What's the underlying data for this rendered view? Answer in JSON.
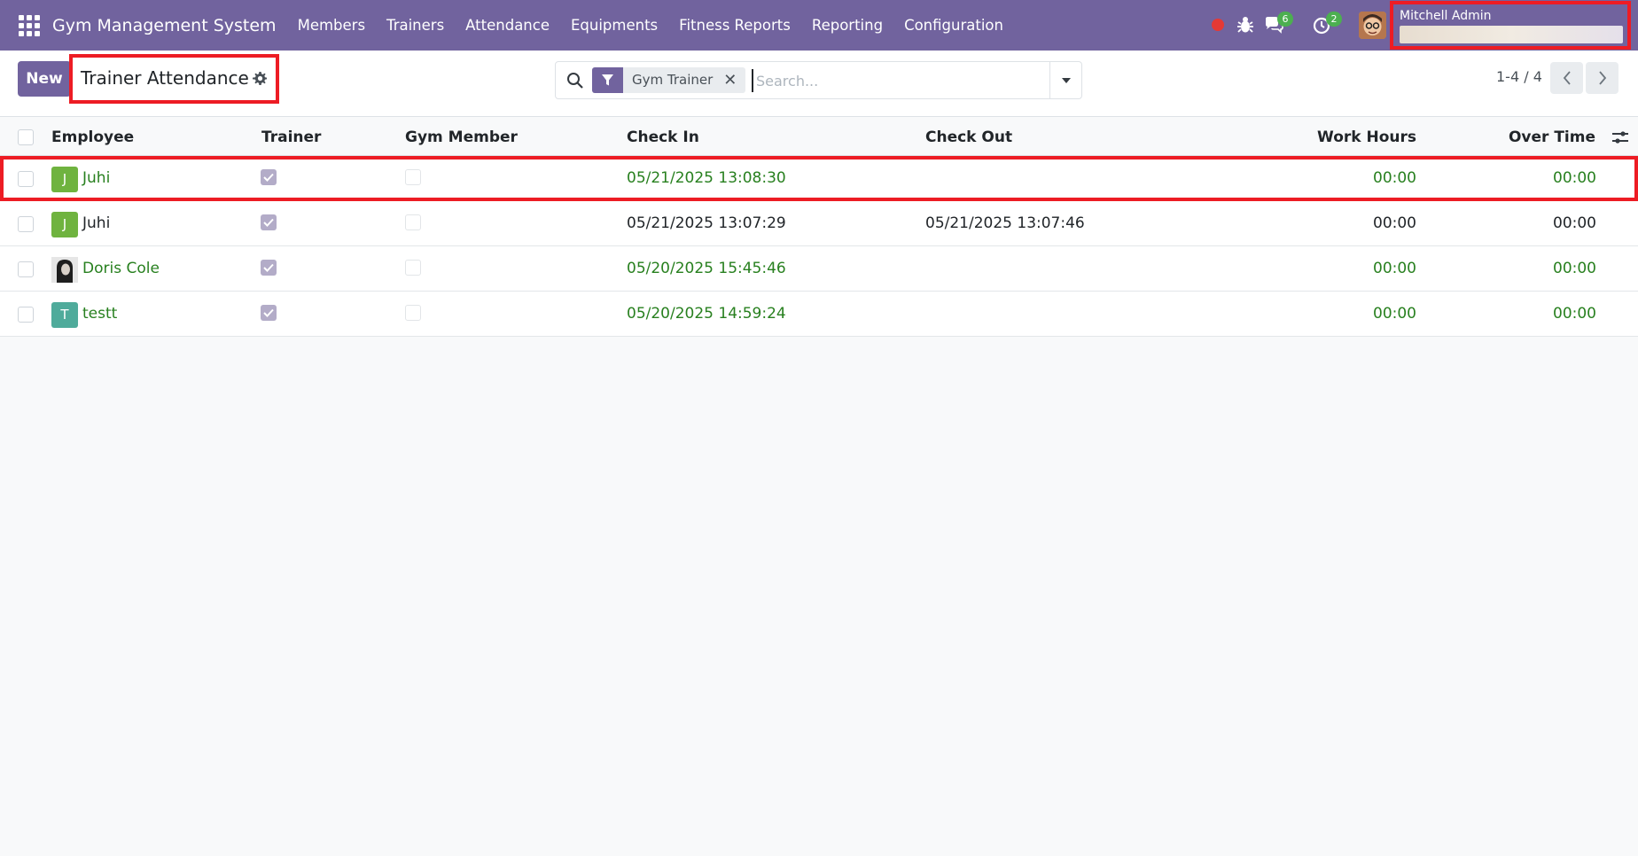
{
  "navbar": {
    "brand": "Gym Management System",
    "menu": [
      "Members",
      "Trainers",
      "Attendance",
      "Equipments",
      "Fitness Reports",
      "Reporting",
      "Configuration"
    ],
    "messages_badge": "6",
    "activities_badge": "2",
    "user_name": "Mitchell Admin",
    "colors": {
      "navbar": "#71639e",
      "badge": "#4caf50",
      "record_dot": "#e53935"
    }
  },
  "control_panel": {
    "new_label": "New",
    "title": "Trainer Attendance",
    "search": {
      "facet_label": "Gym Trainer",
      "placeholder": "Search..."
    },
    "pager": "1-4 / 4"
  },
  "table": {
    "columns": [
      "Employee",
      "Trainer",
      "Gym Member",
      "Check In",
      "Check Out",
      "Work Hours",
      "Over Time"
    ],
    "rows": [
      {
        "initial": "J",
        "avatar_color": "#6fb33f",
        "employee": "Juhi",
        "trainer": true,
        "gym_member": false,
        "check_in": "05/21/2025 13:08:30",
        "check_out": "",
        "work_hours": "00:00",
        "over_time": "00:00",
        "status_color": "#28801f"
      },
      {
        "initial": "J",
        "avatar_color": "#6fb33f",
        "employee": "Juhi",
        "trainer": true,
        "gym_member": false,
        "check_in": "05/21/2025 13:07:29",
        "check_out": "05/21/2025 13:07:46",
        "work_hours": "00:00",
        "over_time": "00:00",
        "status_color": "#212529"
      },
      {
        "initial": "",
        "avatar_color": "photo",
        "employee": "Doris Cole",
        "trainer": true,
        "gym_member": false,
        "check_in": "05/20/2025 15:45:46",
        "check_out": "",
        "work_hours": "00:00",
        "over_time": "00:00",
        "status_color": "#28801f"
      },
      {
        "initial": "T",
        "avatar_color": "#4fab9b",
        "employee": "testt",
        "trainer": true,
        "gym_member": false,
        "check_in": "05/20/2025 14:59:24",
        "check_out": "",
        "work_hours": "00:00",
        "over_time": "00:00",
        "status_color": "#28801f"
      }
    ]
  }
}
